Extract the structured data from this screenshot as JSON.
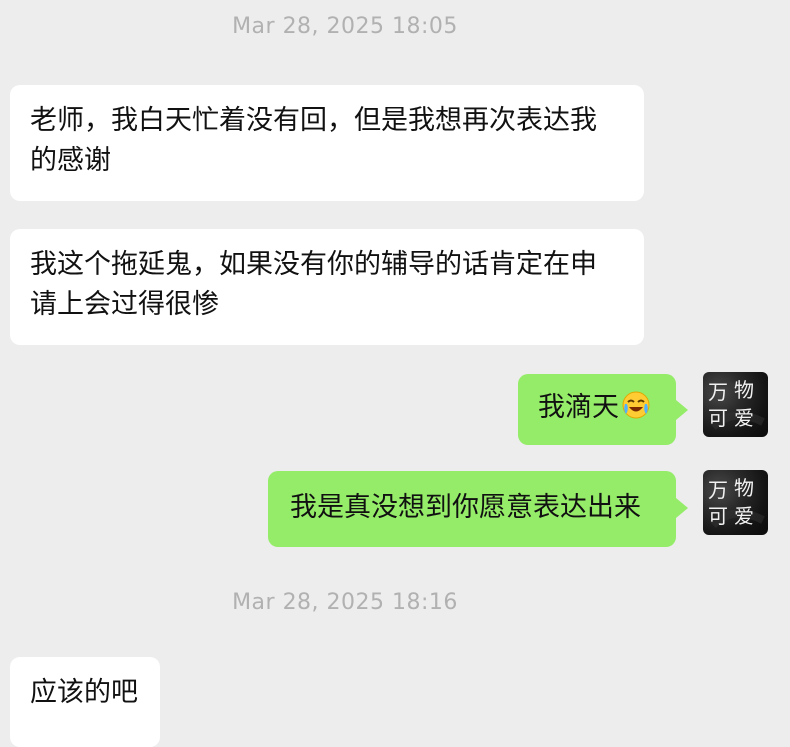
{
  "chat": {
    "timestamps": [
      "Mar 28, 2025 18:05",
      "Mar 28, 2025 18:16"
    ],
    "messages": [
      {
        "sender": "other",
        "lines": [
          "老师，我白天忙着没有回，但是我想再次表达我",
          "的感谢"
        ]
      },
      {
        "sender": "other",
        "lines": [
          "我这个拖延鬼，如果没有你的辅导的话肯定在申",
          "请上会过得很惨"
        ]
      },
      {
        "sender": "self",
        "text": "我滴天",
        "emoji": "crying-laughing-emoji"
      },
      {
        "sender": "self",
        "text": "我是真没想到你愿意表达出来"
      },
      {
        "sender": "other",
        "text": "应该的吧"
      }
    ]
  },
  "avatar": {
    "text": "万物可爱"
  },
  "colors": {
    "background": "#ededed",
    "incoming_bubble": "#ffffff",
    "outgoing_bubble": "#95ec69",
    "timestamp_text": "#b1b1b1"
  }
}
